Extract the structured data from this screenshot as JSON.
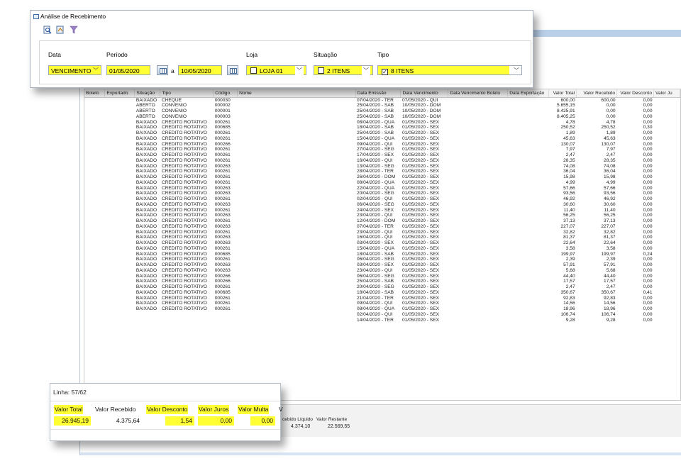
{
  "window": {
    "title": "Análise de Recebimento"
  },
  "toolbar": {
    "icons": [
      "search-doc-icon",
      "export-doc-icon",
      "funnel-filter-icon"
    ]
  },
  "filters": {
    "data_label": "Data",
    "data_value": "VENCIMENTO",
    "periodo_label": "Período",
    "periodo_from": "01/05/2020",
    "periodo_sep": "a",
    "periodo_to": "10/05/2020",
    "loja_label": "Loja",
    "loja_value": "LOJA 01",
    "situacao_label": "Situação",
    "situacao_value": "2 ITENS",
    "tipo_label": "Tipo",
    "tipo_value": "8 ITENS"
  },
  "grid": {
    "columns": [
      "Boleto",
      "Exportado",
      "Situação",
      "Tipo",
      "Código",
      "Nome",
      "Data Emissão",
      "Data Vencimento",
      "Data Vencimento Boleto",
      "Data Exportação",
      "Valor Total",
      "Valor Recebido",
      "Valor Desconto",
      "Valor Ju"
    ],
    "rows": [
      [
        "BAIXADO",
        "CHEQUE",
        "000030",
        "07/04/2020 - TER",
        "07/05/2020 - QUI",
        "600,00",
        "600,00",
        "0,00"
      ],
      [
        "ABERTO",
        "CONVENIO",
        "000002",
        "25/04/2020 - SAB",
        "10/05/2020 - DOM",
        "5.655,15",
        "0,00",
        "0,00"
      ],
      [
        "ABERTO",
        "CONVENIO",
        "000001",
        "25/04/2020 - SAB",
        "10/05/2020 - DOM",
        "8.425,91",
        "0,00",
        "0,00"
      ],
      [
        "ABERTO",
        "CONVENIO",
        "000003",
        "25/04/2020 - SAB",
        "10/05/2020 - DOM",
        "8.405,25",
        "0,00",
        "0,00"
      ],
      [
        "BAIXADO",
        "CREDITO ROTATIVO",
        "000261",
        "08/04/2020 - QUA",
        "01/05/2020 - SEX",
        "4,78",
        "4,78",
        "0,00"
      ],
      [
        "BAIXADO",
        "CREDITO ROTATIVO",
        "000685",
        "18/04/2020 - SAB",
        "01/05/2020 - SEX",
        "250,52",
        "250,52",
        "0,30"
      ],
      [
        "BAIXADO",
        "CREDITO ROTATIVO",
        "000261",
        "25/04/2020 - SAB",
        "01/05/2020 - SEX",
        "1,89",
        "1,89",
        "0,00"
      ],
      [
        "BAIXADO",
        "CREDITO ROTATIVO",
        "000261",
        "15/04/2020 - QUA",
        "01/05/2020 - SEX",
        "45,63",
        "45,63",
        "0,00"
      ],
      [
        "BAIXADO",
        "CREDITO ROTATIVO",
        "000266",
        "09/04/2020 - QUI",
        "01/05/2020 - SEX",
        "130,07",
        "130,07",
        "0,00"
      ],
      [
        "BAIXADO",
        "CREDITO ROTATIVO",
        "000261",
        "27/04/2020 - SEG",
        "01/05/2020 - SEX",
        "7,97",
        "7,97",
        "0,00"
      ],
      [
        "BAIXADO",
        "CREDITO ROTATIVO",
        "000261",
        "17/04/2020 - SEX",
        "01/05/2020 - SEX",
        "2,47",
        "2,47",
        "0,00"
      ],
      [
        "BAIXADO",
        "CREDITO ROTATIVO",
        "000261",
        "16/04/2020 - QUI",
        "01/05/2020 - SEX",
        "28,35",
        "28,35",
        "0,00"
      ],
      [
        "BAIXADO",
        "CREDITO ROTATIVO",
        "000263",
        "13/04/2020 - SEG",
        "01/05/2020 - SEX",
        "74,08",
        "74,08",
        "0,00"
      ],
      [
        "BAIXADO",
        "CREDITO ROTATIVO",
        "000261",
        "28/04/2020 - TER",
        "01/05/2020 - SEX",
        "36,04",
        "36,04",
        "0,00"
      ],
      [
        "BAIXADO",
        "CREDITO ROTATIVO",
        "000261",
        "26/04/2020 - DOM",
        "01/05/2020 - SEX",
        "15,98",
        "15,98",
        "0,00"
      ],
      [
        "BAIXADO",
        "CREDITO ROTATIVO",
        "000261",
        "08/04/2020 - QUA",
        "01/05/2020 - SEX",
        "4,99",
        "4,99",
        "0,00"
      ],
      [
        "BAIXADO",
        "CREDITO ROTATIVO",
        "000263",
        "22/04/2020 - QUA",
        "01/05/2020 - SEX",
        "57,66",
        "57,66",
        "0,00"
      ],
      [
        "BAIXADO",
        "CREDITO ROTATIVO",
        "000263",
        "20/04/2020 - SEG",
        "01/05/2020 - SEX",
        "93,56",
        "93,56",
        "0,00"
      ],
      [
        "BAIXADO",
        "CREDITO ROTATIVO",
        "000261",
        "02/04/2020 - QUI",
        "01/05/2020 - SEX",
        "46,92",
        "46,92",
        "0,00"
      ],
      [
        "BAIXADO",
        "CREDITO ROTATIVO",
        "000263",
        "06/04/2020 - SEG",
        "01/05/2020 - SEX",
        "30,60",
        "30,60",
        "0,00"
      ],
      [
        "BAIXADO",
        "CREDITO ROTATIVO",
        "000261",
        "24/04/2020 - SEX",
        "01/05/2020 - SEX",
        "11,40",
        "11,40",
        "0,00"
      ],
      [
        "BAIXADO",
        "CREDITO ROTATIVO",
        "000263",
        "23/04/2020 - QUI",
        "01/05/2020 - SEX",
        "56,25",
        "56,25",
        "0,00"
      ],
      [
        "BAIXADO",
        "CREDITO ROTATIVO",
        "000261",
        "12/04/2020 - DOM",
        "01/05/2020 - SEX",
        "37,13",
        "37,13",
        "0,00"
      ],
      [
        "BAIXADO",
        "CREDITO ROTATIVO",
        "000263",
        "07/04/2020 - TER",
        "01/05/2020 - SEX",
        "227,07",
        "227,07",
        "0,00"
      ],
      [
        "BAIXADO",
        "CREDITO ROTATIVO",
        "000261",
        "23/04/2020 - QUI",
        "01/05/2020 - SEX",
        "32,82",
        "32,82",
        "0,00"
      ],
      [
        "BAIXADO",
        "CREDITO ROTATIVO",
        "000263",
        "16/04/2020 - QUI",
        "01/05/2020 - SEX",
        "81,37",
        "81,37",
        "0,00"
      ],
      [
        "BAIXADO",
        "CREDITO ROTATIVO",
        "000263",
        "03/04/2020 - SEX",
        "01/05/2020 - SEX",
        "22,64",
        "22,64",
        "0,00"
      ],
      [
        "BAIXADO",
        "CREDITO ROTATIVO",
        "000261",
        "15/04/2020 - QUA",
        "01/05/2020 - SEX",
        "3,58",
        "3,58",
        "0,00"
      ],
      [
        "BAIXADO",
        "CREDITO ROTATIVO",
        "000685",
        "18/04/2020 - SAB",
        "01/05/2020 - SEX",
        "199,97",
        "199,97",
        "0,24"
      ],
      [
        "BAIXADO",
        "CREDITO ROTATIVO",
        "000261",
        "06/04/2020 - SEG",
        "01/05/2020 - SEX",
        "2,39",
        "2,39",
        "0,00"
      ],
      [
        "BAIXADO",
        "CREDITO ROTATIVO",
        "000263",
        "03/04/2020 - SEX",
        "01/05/2020 - SEX",
        "57,91",
        "57,91",
        "0,00"
      ],
      [
        "BAIXADO",
        "CREDITO ROTATIVO",
        "000263",
        "23/04/2020 - QUI",
        "01/05/2020 - SEX",
        "5,68",
        "5,68",
        "0,00"
      ],
      [
        "BAIXADO",
        "CREDITO ROTATIVO",
        "000266",
        "06/04/2020 - SEG",
        "01/05/2020 - SEX",
        "44,40",
        "44,40",
        "0,00"
      ],
      [
        "BAIXADO",
        "CREDITO ROTATIVO",
        "000266",
        "25/04/2020 - SAB",
        "01/05/2020 - SEX",
        "17,57",
        "17,57",
        "0,00"
      ],
      [
        "BAIXADO",
        "CREDITO ROTATIVO",
        "000261",
        "20/04/2020 - SEG",
        "01/05/2020 - SEX",
        "2,47",
        "2,47",
        "0,00"
      ],
      [
        "BAIXADO",
        "CREDITO ROTATIVO",
        "000685",
        "18/04/2020 - SAB",
        "01/05/2020 - SEX",
        "350,67",
        "350,67",
        "0,41"
      ],
      [
        "BAIXADO",
        "CREDITO ROTATIVO",
        "000261",
        "21/04/2020 - TER",
        "01/05/2020 - SEX",
        "92,83",
        "92,83",
        "0,00"
      ],
      [
        "BAIXADO",
        "CREDITO ROTATIVO",
        "000261",
        "09/04/2020 - QUI",
        "01/05/2020 - SEX",
        "14,56",
        "14,56",
        "0,00"
      ],
      [
        "BAIXADO",
        "CREDITO ROTATIVO",
        "000261",
        "08/04/2020 - QUA",
        "01/05/2020 - SEX",
        "18,96",
        "18,96",
        "0,00"
      ],
      [
        "",
        "",
        "",
        "02/04/2020 - QUI",
        "01/05/2020 - SEX",
        "106,74",
        "106,74",
        "0,00"
      ],
      [
        "",
        "",
        "",
        "14/04/2020 - TER",
        "01/05/2020 - SEX",
        "9,28",
        "9,28",
        "0,00"
      ]
    ]
  },
  "totals": {
    "linha": "Linha: 57/62",
    "labels": [
      "Valor Total",
      "Valor Recebido",
      "Valor Desconto",
      "Valor Juros",
      "Valor Multa",
      "V"
    ],
    "values": [
      "26.945,19",
      "4.375,64",
      "1,54",
      "0,00",
      "0,00"
    ]
  },
  "bottom_panel": {
    "labels": [
      "cebido Líquido",
      "Valor Restante"
    ],
    "values": [
      "4.374,10",
      "22.569,55"
    ]
  },
  "colors": {
    "highlight": "#ffff33",
    "title_bar": "#b8d0e8"
  }
}
